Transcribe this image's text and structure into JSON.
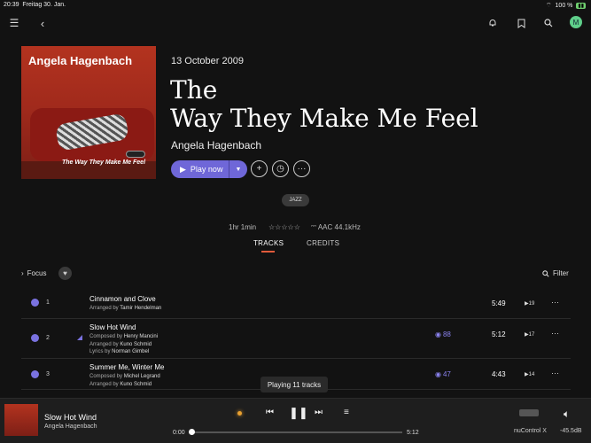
{
  "status": {
    "time": "20:39",
    "date": "Freitag 30. Jan.",
    "battery": "100 %"
  },
  "header": {
    "avatar": "M"
  },
  "album": {
    "cover_artist": "Angela Hagenbach",
    "cover_title": "The Way They Make Me Feel",
    "release_date": "13 October 2009",
    "title_line1": "The",
    "title_line2": "Way They Make Me Feel",
    "artist": "Angela Hagenbach",
    "play_label": "Play now",
    "genre": "JAZZ",
    "duration": "1hr 1min",
    "rating": "☆☆☆☆☆",
    "format": "AAC 44.1kHz"
  },
  "tabs": {
    "tracks": "TRACKS",
    "credits": "CREDITS"
  },
  "list_controls": {
    "focus": "Focus",
    "filter": "Filter"
  },
  "tracks": [
    {
      "num": "1",
      "title": "Cinnamon and Clove",
      "credits": [
        [
          "Arranged by",
          "Tamir Hendelman"
        ]
      ],
      "plays": "",
      "duration": "5:49",
      "playcount": "19"
    },
    {
      "num": "2",
      "title": "Slow Hot Wind",
      "credits": [
        [
          "Composed by",
          "Henry Mancini"
        ],
        [
          "Arranged by",
          "Kuno Schmid"
        ],
        [
          "Lyrics by",
          "Norman Gimbel"
        ]
      ],
      "plays": "88",
      "duration": "5:12",
      "playcount": "17"
    },
    {
      "num": "3",
      "title": "Summer Me, Winter Me",
      "credits": [
        [
          "Composed by",
          "Michel Legrand"
        ],
        [
          "Arranged by",
          "Kuno Schmid"
        ]
      ],
      "plays": "47",
      "duration": "4:43",
      "playcount": "14"
    }
  ],
  "toast": "Playing 11 tracks",
  "player": {
    "title": "Slow Hot Wind",
    "artist": "Angela Hagenbach",
    "elapsed": "0:00",
    "total": "5:12",
    "progress": 0.0,
    "device": "nuControl X",
    "volume": "-45.5dB"
  },
  "colors": {
    "accent": "#6f67d8",
    "tab_underline": "#e05a3a",
    "background": "#121212"
  }
}
